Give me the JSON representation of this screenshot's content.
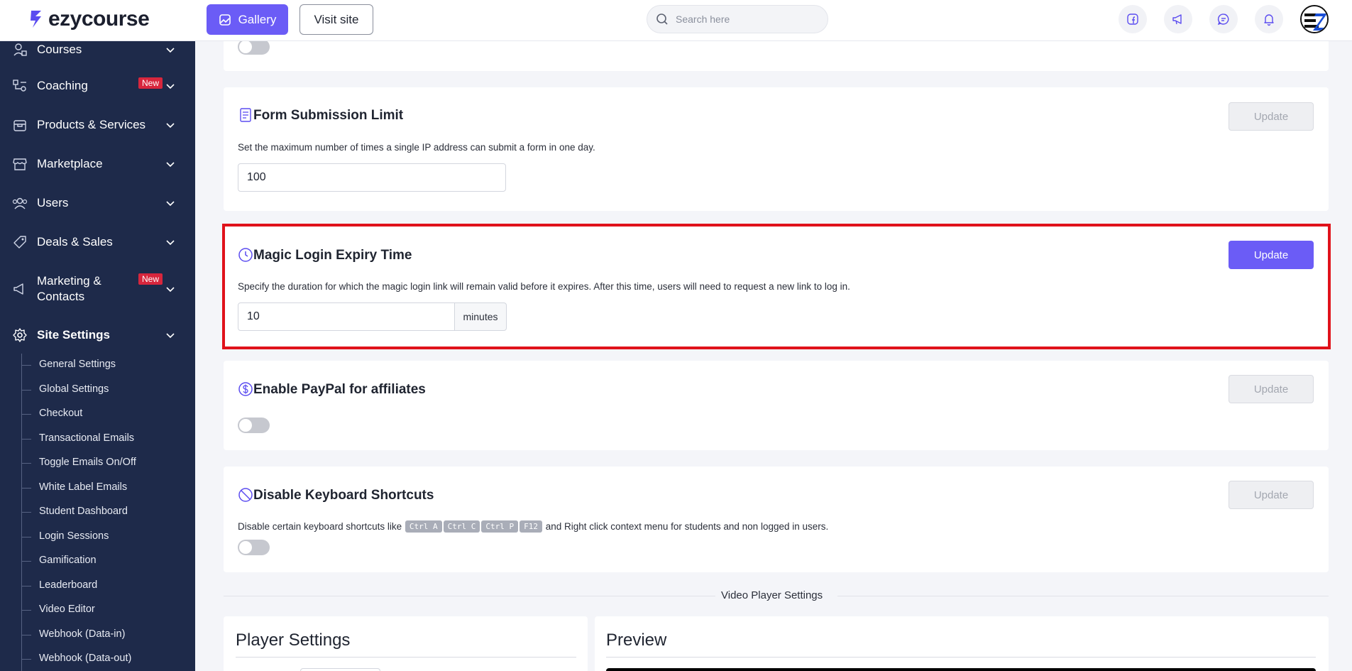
{
  "header": {
    "logo_text": "ezycourse",
    "gallery_label": "Gallery",
    "visit_label": "Visit site",
    "search_placeholder": "Search here",
    "icons": [
      "facebook-icon",
      "megaphone-icon",
      "chat-icon",
      "bell-icon"
    ]
  },
  "sidebar": {
    "items": [
      {
        "label": "Courses",
        "icon": "courses-icon"
      },
      {
        "label": "Coaching",
        "icon": "coaching-icon",
        "badge": "New"
      },
      {
        "label": "Products & Services",
        "icon": "products-icon"
      },
      {
        "label": "Marketplace",
        "icon": "marketplace-icon"
      },
      {
        "label": "Users",
        "icon": "users-icon"
      },
      {
        "label": "Deals & Sales",
        "icon": "tag-icon"
      },
      {
        "label": "Marketing &",
        "label2": "Contacts",
        "icon": "megaphone-icon",
        "badge": "New"
      },
      {
        "label": "Site Settings",
        "icon": "gear-icon",
        "active": true
      }
    ],
    "sub_items": [
      "General Settings",
      "Global Settings",
      "Checkout",
      "Transactional Emails",
      "Toggle Emails On/Off",
      "White Label Emails",
      "Student Dashboard",
      "Login Sessions",
      "Gamification",
      "Leaderboard",
      "Video Editor",
      "Webhook (Data-in)",
      "Webhook (Data-out)"
    ]
  },
  "main": {
    "form_limit": {
      "title": "Form Submission Limit",
      "description": "Set the maximum number of times a single IP address can submit a form in one day.",
      "value": "100",
      "update_label": "Update"
    },
    "magic_login": {
      "title": "Magic Login Expiry Time",
      "description": "Specify the duration for which the magic login link will remain valid before it expires. After this time, users will need to request a new link to log in.",
      "value": "10",
      "unit": "minutes",
      "update_label": "Update"
    },
    "paypal": {
      "title": "Enable PayPal for affiliates",
      "update_label": "Update"
    },
    "shortcuts": {
      "title": "Disable Keyboard Shortcuts",
      "desc_prefix": "Disable certain keyboard shortcuts like",
      "keys": [
        "Ctrl A",
        "Ctrl C",
        "Ctrl P",
        "F12"
      ],
      "desc_suffix": "and Right click context menu for students and non logged in users.",
      "update_label": "Update"
    },
    "video_section_label": "Video Player Settings",
    "player_settings_title": "Player Settings",
    "preview_title": "Preview"
  },
  "colors": {
    "accent": "#6b5cf6",
    "sidebar_bg": "#1e2a4a",
    "badge_red": "#d7263d",
    "highlight_red": "#e0121b"
  }
}
